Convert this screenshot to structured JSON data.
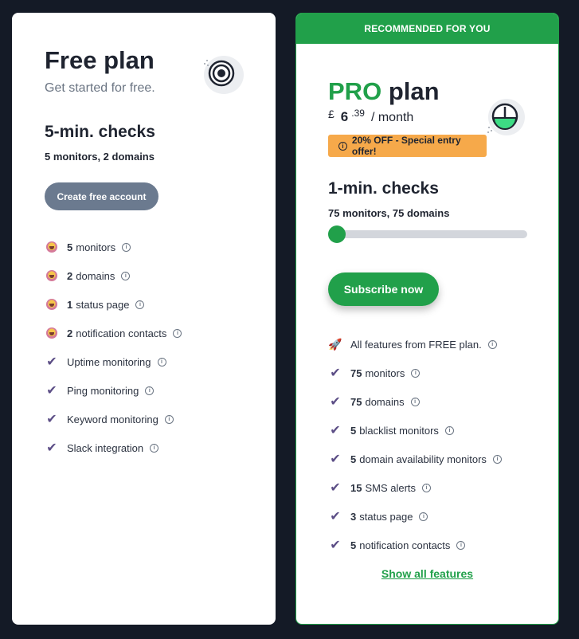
{
  "free": {
    "title": "Free plan",
    "subtitle": "Get started for free.",
    "checks": "5-min. checks",
    "sub_checks": "5 monitors, 2 domains",
    "button": "Create free account",
    "features": [
      {
        "icon": "emoji-icon",
        "num": "5",
        "label": "monitors"
      },
      {
        "icon": "emoji-icon",
        "num": "2",
        "label": "domains"
      },
      {
        "icon": "emoji-icon",
        "num": "1",
        "label": "status page"
      },
      {
        "icon": "emoji-icon",
        "num": "2",
        "label": "notification contacts"
      },
      {
        "icon": "check-icon",
        "num": "",
        "label": "Uptime monitoring"
      },
      {
        "icon": "check-icon",
        "num": "",
        "label": "Ping monitoring"
      },
      {
        "icon": "check-icon",
        "num": "",
        "label": "Keyword monitoring"
      },
      {
        "icon": "check-icon",
        "num": "",
        "label": "Slack integration"
      }
    ]
  },
  "pro": {
    "banner": "RECOMMENDED FOR YOU",
    "title_accent": "PRO",
    "title_rest": "plan",
    "price_currency": "£",
    "price_int": "6",
    "price_dec": ".39",
    "price_per": "/ month",
    "offer": "20% OFF - Special entry offer!",
    "checks": "1-min. checks",
    "sub_checks": "75 monitors, 75 domains",
    "slider_level": 0,
    "button": "Subscribe now",
    "features": [
      {
        "icon": "rocket-icon",
        "num": "",
        "label": "All features from FREE plan."
      },
      {
        "icon": "check-icon",
        "num": "75",
        "label": "monitors"
      },
      {
        "icon": "check-icon",
        "num": "75",
        "label": "domains"
      },
      {
        "icon": "check-icon",
        "num": "5",
        "label": "blacklist monitors"
      },
      {
        "icon": "check-icon",
        "num": "5",
        "label": "domain availability monitors"
      },
      {
        "icon": "check-icon",
        "num": "15",
        "label": "SMS alerts"
      },
      {
        "icon": "check-icon",
        "num": "3",
        "label": "status page"
      },
      {
        "icon": "check-icon",
        "num": "5",
        "label": "notification contacts"
      }
    ],
    "show_all": "Show all features"
  },
  "colors": {
    "background": "#141a26",
    "accent_green": "#21a04a",
    "offer_orange": "#f6a94a",
    "free_button": "#6b7a8f",
    "check_purple": "#5c4e86"
  }
}
